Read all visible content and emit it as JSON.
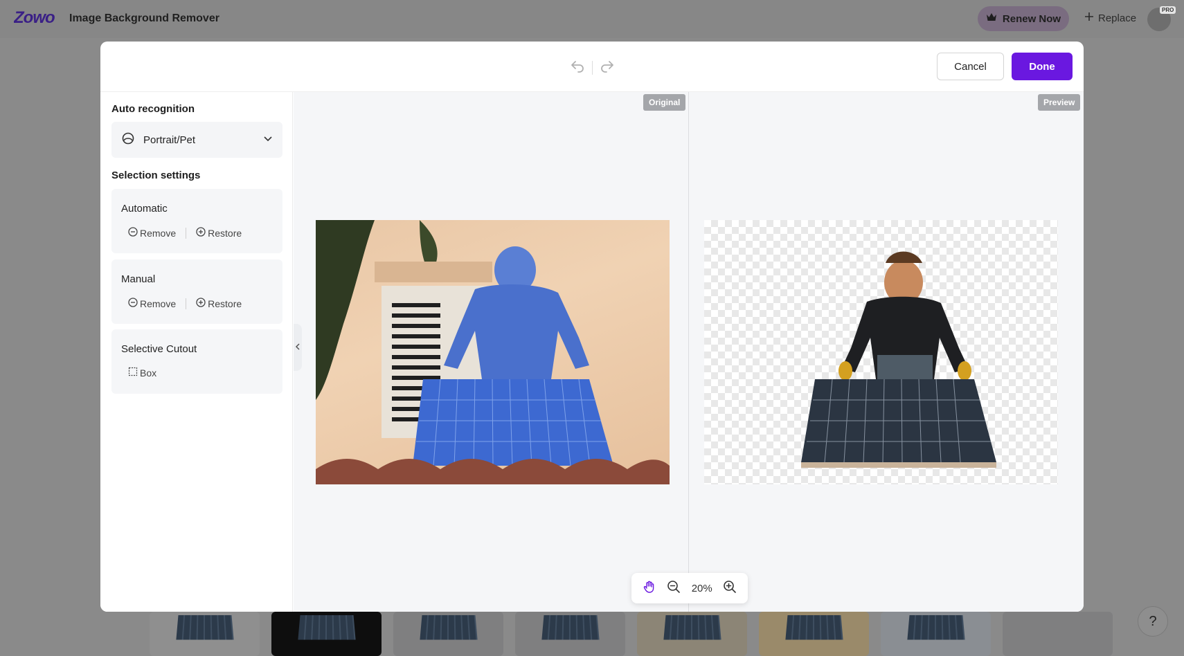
{
  "app": {
    "logo_text": "Zowo",
    "title": "Image Background Remover",
    "renew_label": "Renew Now",
    "replace_label": "Replace",
    "pro_badge": "PRO",
    "help_label": "?"
  },
  "modal": {
    "cancel_label": "Cancel",
    "done_label": "Done",
    "accent_color": "#6a18e0"
  },
  "sidebar": {
    "auto_recognition_title": "Auto recognition",
    "mode_selected": "Portrait/Pet",
    "selection_settings_title": "Selection settings",
    "automatic": {
      "title": "Automatic",
      "remove_label": "Remove",
      "restore_label": "Restore"
    },
    "manual": {
      "title": "Manual",
      "remove_label": "Remove",
      "restore_label": "Restore"
    },
    "selective": {
      "title": "Selective Cutout",
      "box_label": "Box"
    }
  },
  "canvas": {
    "original_tag": "Original",
    "preview_tag": "Preview",
    "zoom_level": "20%"
  },
  "icons": {
    "undo": "undo-icon",
    "redo": "redo-icon",
    "crown": "crown-icon",
    "plus": "plus-icon",
    "portrait": "portrait-icon",
    "chevron": "chevron-down-icon",
    "minus_circle": "minus-circle-icon",
    "plus_circle": "plus-circle-icon",
    "box": "box-select-icon",
    "hand": "hand-icon",
    "zoom_out": "zoom-out-icon",
    "zoom_in": "zoom-in-icon"
  }
}
